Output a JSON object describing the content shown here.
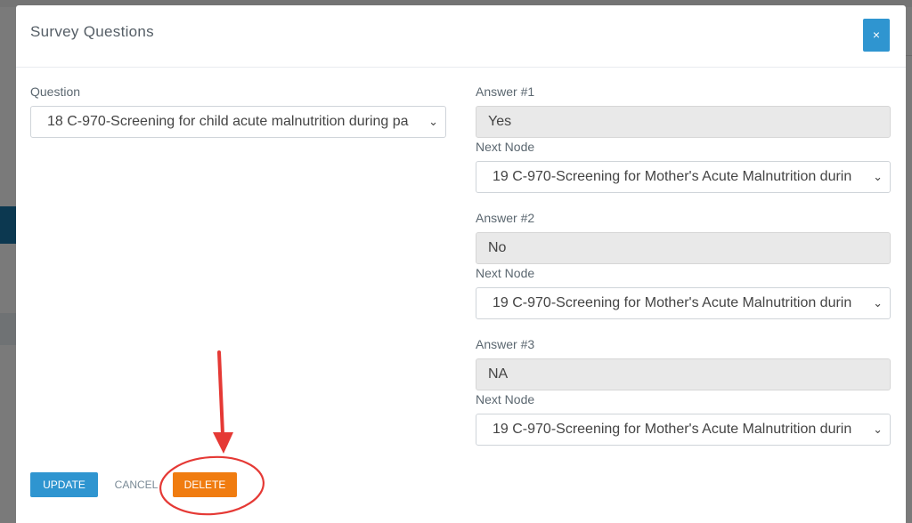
{
  "modal": {
    "title": "Survey Questions",
    "close_label": "×"
  },
  "question": {
    "label": "Question",
    "selected": "18 C-970-Screening for child acute malnutrition during pa"
  },
  "answers": [
    {
      "label": "Answer #1",
      "value": "Yes",
      "next_label": "Next Node",
      "next_selected": "19 C-970-Screening for Mother's Acute Malnutrition durin"
    },
    {
      "label": "Answer #2",
      "value": "No",
      "next_label": "Next Node",
      "next_selected": "19 C-970-Screening for Mother's Acute Malnutrition durin"
    },
    {
      "label": "Answer #3",
      "value": "NA",
      "next_label": "Next Node",
      "next_selected": "19 C-970-Screening for Mother's Acute Malnutrition durin"
    }
  ],
  "buttons": {
    "update": "UPDATE",
    "cancel": "CANCEL",
    "delete": "DELETE"
  },
  "annotation": {
    "color": "#e53935"
  }
}
